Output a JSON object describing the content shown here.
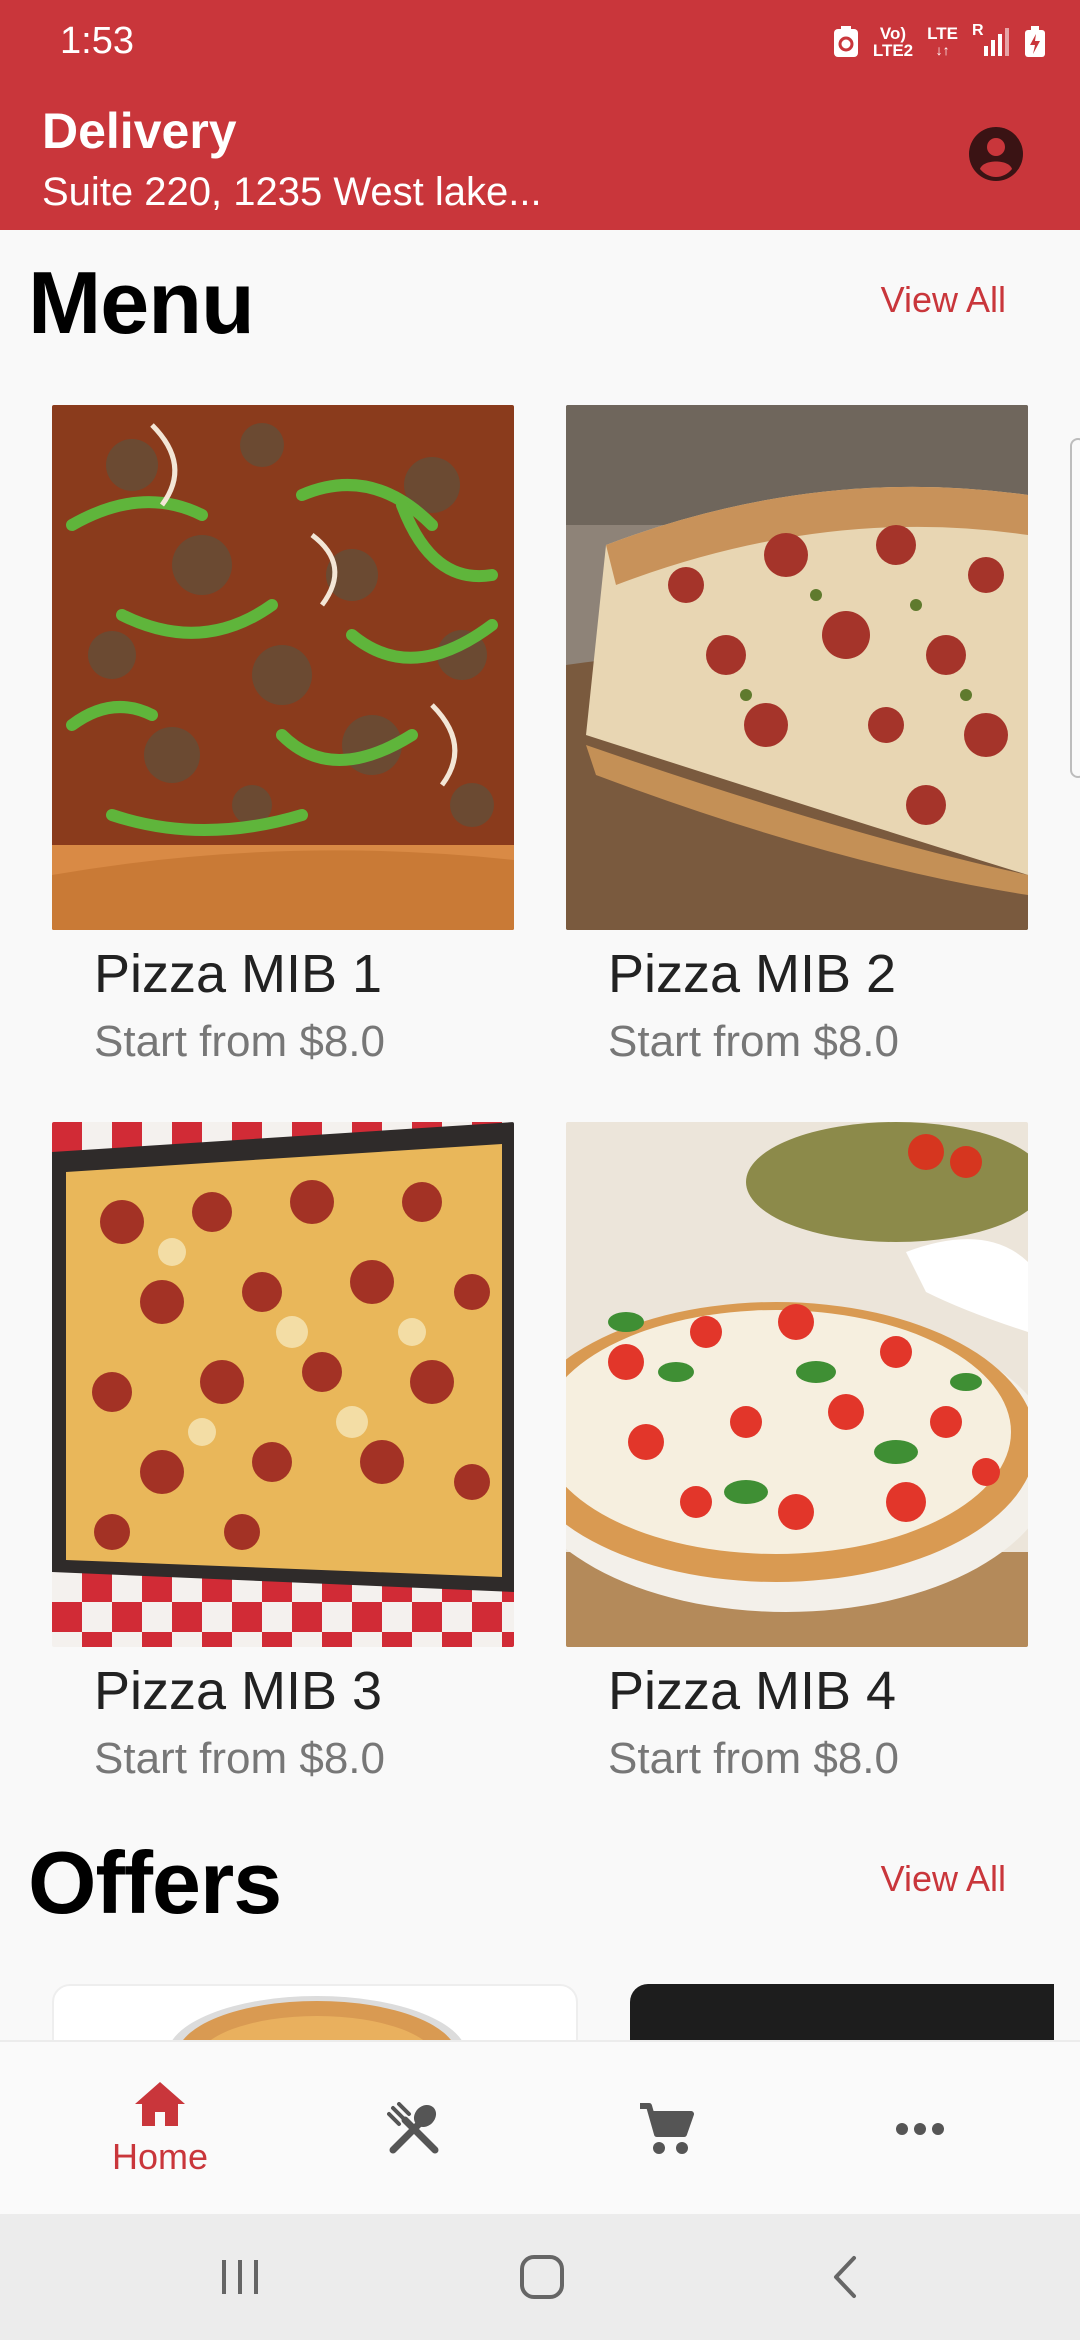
{
  "status_bar": {
    "time": "1:53",
    "net_top": "Vo)",
    "net_bottom": "LTE2",
    "lte_label": "LTE",
    "roaming": "R"
  },
  "header": {
    "title": "Delivery",
    "address": "Suite 220, 1235 West lake..."
  },
  "menu_section": {
    "title": "Menu",
    "view_all": "View All",
    "items": [
      {
        "name": "Pizza MIB 1",
        "price": "Start from $8.0"
      },
      {
        "name": "Pizza MIB 2",
        "price": "Start from $8.0"
      },
      {
        "name": "Pizza MIB 3",
        "price": "Start from $8.0"
      },
      {
        "name": "Pizza MIB 4",
        "price": "Start from $8.0"
      }
    ]
  },
  "offers_section": {
    "title": "Offers",
    "view_all": "View All"
  },
  "bottom_nav": {
    "items": [
      {
        "icon": "home-icon",
        "label": "Home",
        "active": true
      },
      {
        "icon": "utensils-icon"
      },
      {
        "icon": "cart-icon"
      },
      {
        "icon": "more-icon"
      }
    ]
  },
  "colors": {
    "brand_red": "#c9363b",
    "inactive_icon": "#555555"
  }
}
